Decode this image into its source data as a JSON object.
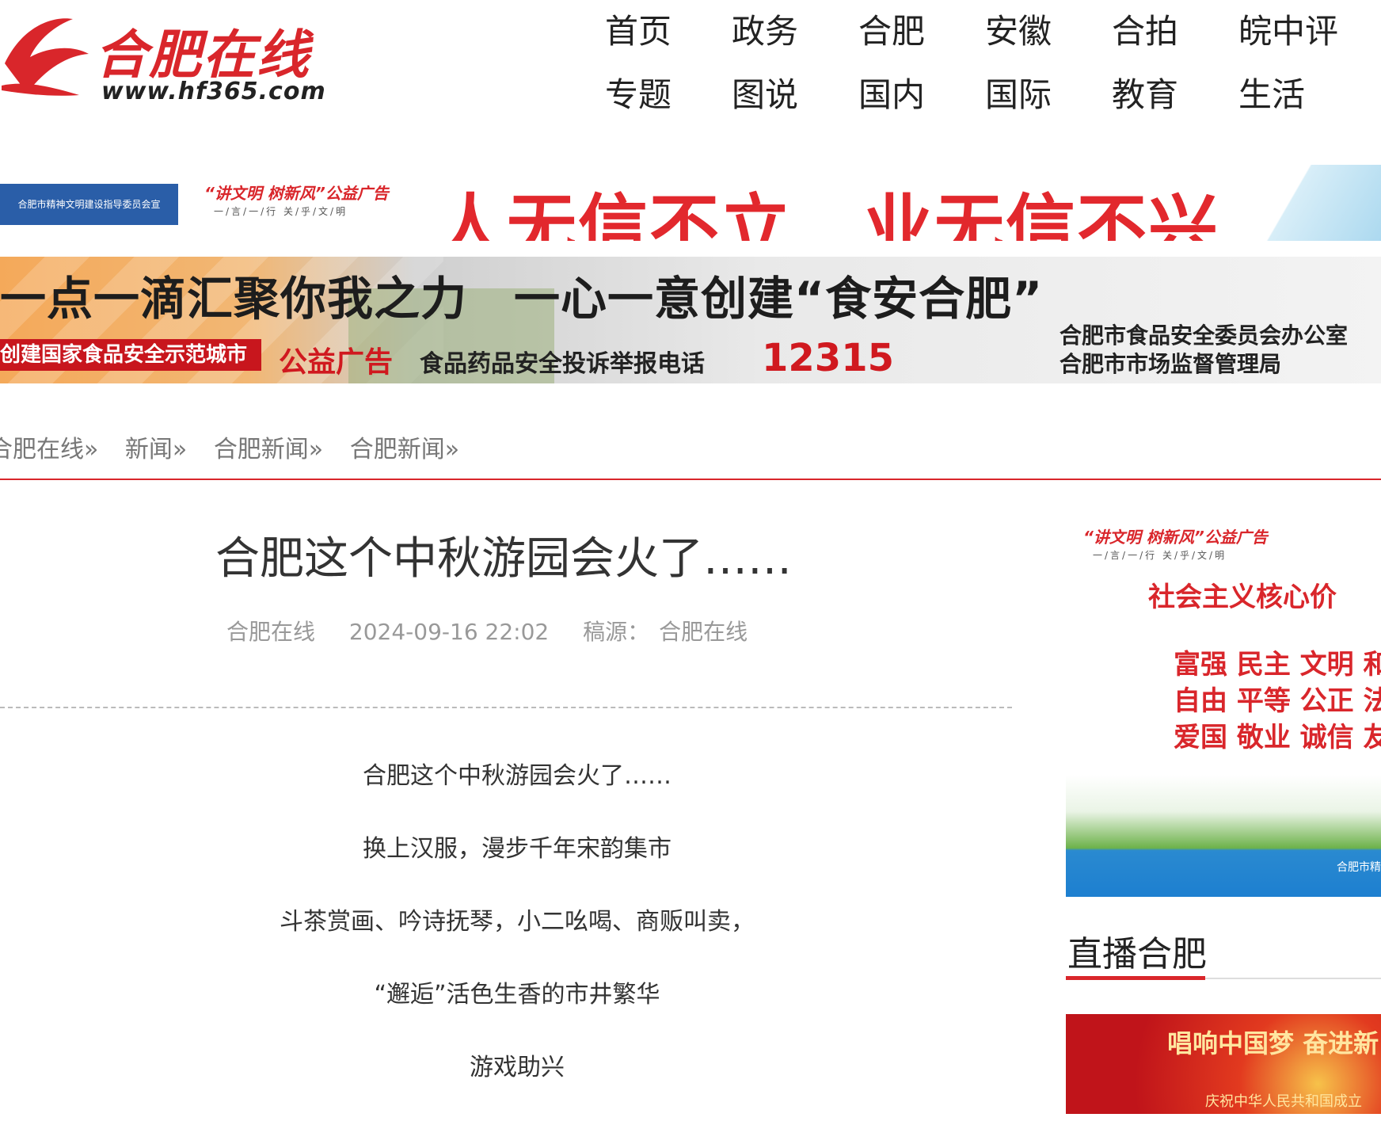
{
  "site": {
    "logo_text": "合肥在线",
    "logo_url": "www.hf365.com"
  },
  "nav": {
    "row1": [
      "首页",
      "政务",
      "合肥",
      "安徽",
      "合拍",
      "皖中评"
    ],
    "row2": [
      "专题",
      "图说",
      "国内",
      "国际",
      "教育",
      "生活"
    ]
  },
  "banner1": {
    "org": "合肥市精神文明建设指导委员会宣",
    "tag": "“讲文明 树新风”公益广告",
    "tag_sub": "一/言/一/行  关/乎/文/明",
    "slogan": "人无信不立　业无信不兴"
  },
  "banner2": {
    "headline": "一点一滴汇聚你我之力　一心一意创建“食安合肥”",
    "red_tag": "创建国家食品安全示范城市",
    "pub": "公益广告",
    "hotline_label": "食品药品安全投诉举报电话",
    "hotline": "12315",
    "org1": "合肥市食品安全委员会办公室",
    "org2": "合肥市市场监督管理局"
  },
  "breadcrumb": [
    "合肥在线»",
    "新闻»",
    "合肥新闻»",
    "合肥新闻»"
  ],
  "article": {
    "title": "合肥这个中秋游园会火了……",
    "author": "合肥在线",
    "datetime": "2024-09-16 22:02",
    "source_label": "稿源：",
    "source": "合肥在线",
    "paragraphs": [
      "合肥这个中秋游园会火了……",
      "换上汉服，漫步千年宋韵集市",
      "斗茶赏画、吟诗抚琴，小二吆喝、商贩叫卖，",
      "“邂逅”活色生香的市井繁华",
      "游戏助兴"
    ]
  },
  "sidebar": {
    "ad_tag": "“讲文明 树新风”公益广告",
    "ad_tag_sub": "一/言/一/行  关/乎/文/明",
    "ad_core": "社会主义核心价",
    "ad_values": [
      "富强 民主 文明 和",
      "自由 平等 公正 法",
      "爱国 敬业 诚信 友"
    ],
    "ad_org": "合肥市精",
    "live_title": "直播合肥",
    "live_thumb_title": "唱响中国梦 奋进新",
    "live_thumb_sub": "庆祝中华人民共和国成立"
  },
  "colors": {
    "brand_red": "#d9262b",
    "banner_blue": "#2a5ea8"
  }
}
